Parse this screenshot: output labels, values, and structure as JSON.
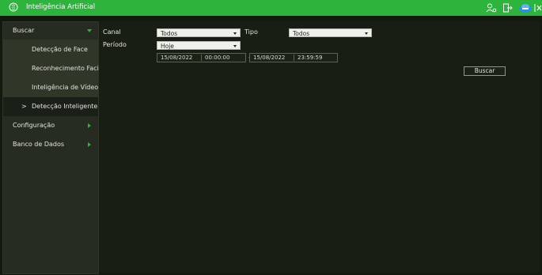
{
  "window": {
    "title": "Inteligência Artificial",
    "accent_color": "#2db43c",
    "icons": [
      "brain-icon",
      "user-settings-icon",
      "logout-icon",
      "cloud-network-icon",
      "close-icon"
    ]
  },
  "sidebar": {
    "items": [
      {
        "label": "Buscar",
        "expanded": true
      },
      {
        "label": "Detecção de Face"
      },
      {
        "label": "Reconhecimento Facial"
      },
      {
        "label": "Inteligência de Vídeo"
      },
      {
        "label": "Detecção Inteligente",
        "marker": ">",
        "selected": true
      },
      {
        "label": "Configuração",
        "expanded": false
      },
      {
        "label": "Banco de Dados",
        "expanded": false
      }
    ]
  },
  "form": {
    "canal": {
      "label": "Canal",
      "value": "Todos"
    },
    "tipo": {
      "label": "Tipo",
      "value": "Todos"
    },
    "periodo": {
      "label": "Período",
      "value": "Hoje"
    },
    "start": {
      "date": "15/08/2022",
      "time": "00:00:00"
    },
    "range_separator": "-",
    "end": {
      "date": "15/08/2022",
      "time": "23:59:59"
    },
    "search_button": "Buscar"
  }
}
